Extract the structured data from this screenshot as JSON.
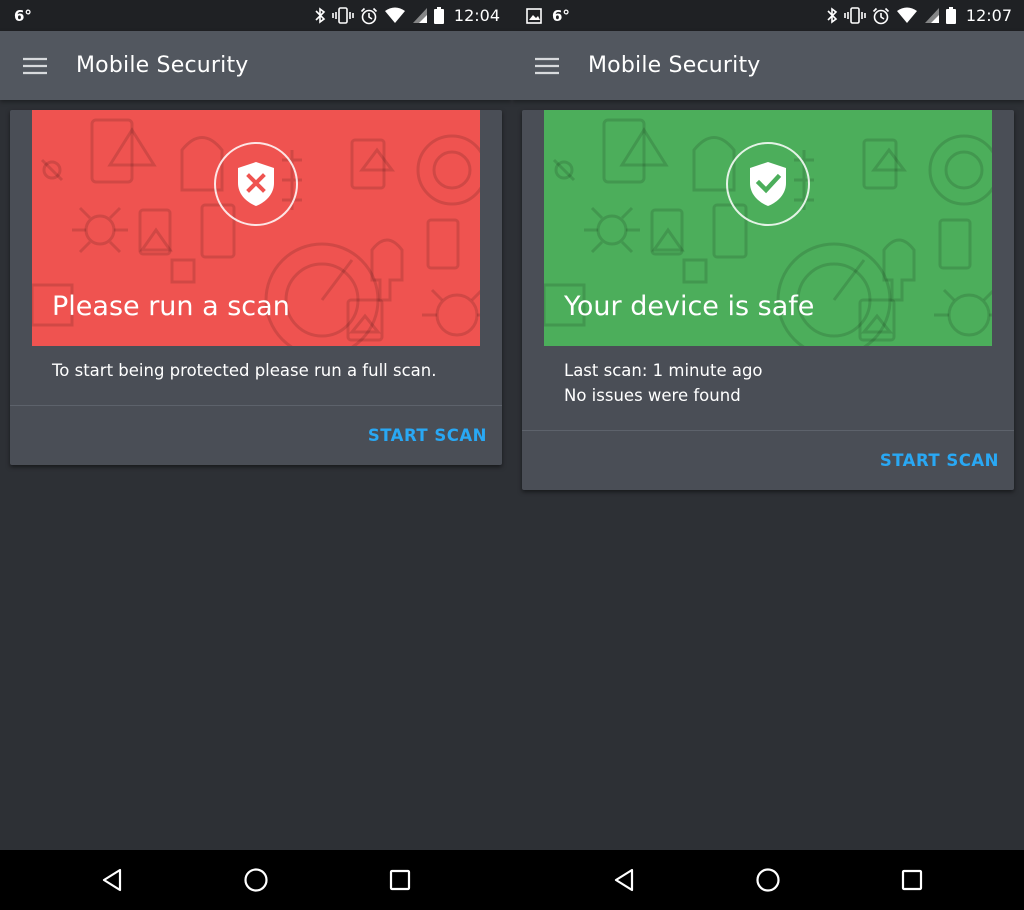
{
  "screens": [
    {
      "status": {
        "left_text": "6°",
        "has_image_icon": false,
        "time": "12:04"
      },
      "app_title": "Mobile Security",
      "card": {
        "state": "unscanned",
        "hero_color": "#ef5350",
        "hero_title": "Please run a scan",
        "body_lines": [
          "To start being protected please run a full scan."
        ],
        "action_label": "START SCAN"
      }
    },
    {
      "status": {
        "left_text": "6°",
        "has_image_icon": true,
        "time": "12:07"
      },
      "app_title": "Mobile Security",
      "card": {
        "state": "safe",
        "hero_color": "#4cae5b",
        "hero_title": "Your device is safe",
        "body_lines": [
          "Last scan: 1 minute ago",
          "No issues were found"
        ],
        "action_label": "START SCAN"
      }
    }
  ],
  "icons": {
    "status": [
      "bluetooth-icon",
      "vibrate-icon",
      "alarm-icon",
      "wifi-icon",
      "signal-icon",
      "battery-icon"
    ],
    "nav": [
      "back-icon",
      "home-icon",
      "recents-icon"
    ],
    "hero_red": "shield-x-icon",
    "hero_green": "shield-check-icon"
  },
  "colors": {
    "accent": "#29a8f4",
    "background": "#2d3035",
    "appbar": "#52575f"
  }
}
